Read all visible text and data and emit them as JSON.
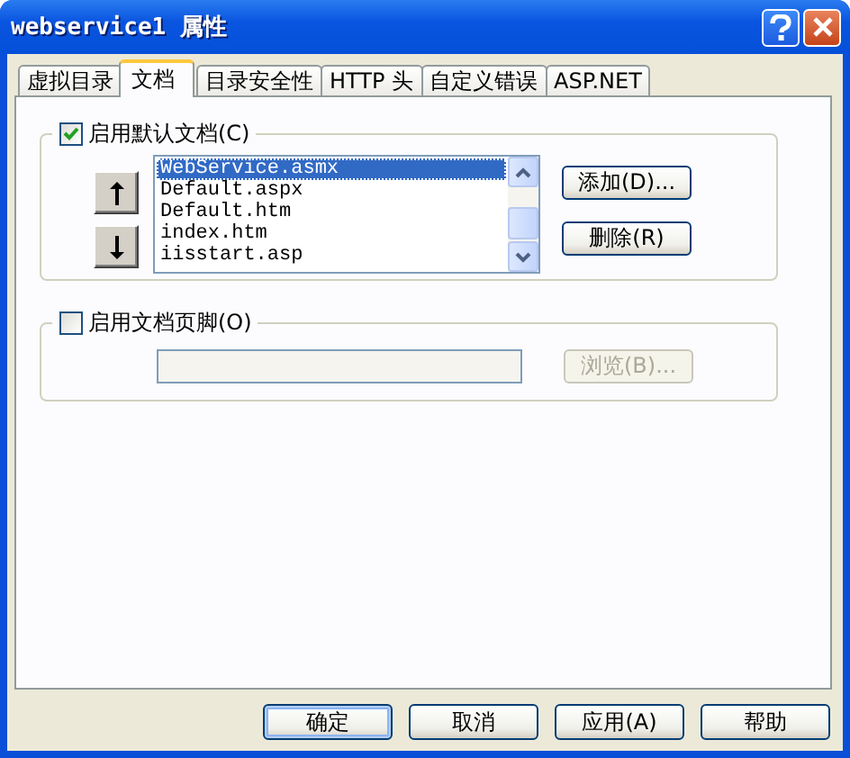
{
  "window": {
    "title": "webservice1 属性"
  },
  "tabs": [
    {
      "label": "虚拟目录",
      "selected": false
    },
    {
      "label": "文档",
      "selected": true
    },
    {
      "label": "目录安全性",
      "selected": false
    },
    {
      "label": "HTTP 头",
      "selected": false
    },
    {
      "label": "自定义错误",
      "selected": false
    },
    {
      "label": "ASP.NET",
      "selected": false
    }
  ],
  "default_document": {
    "label": "启用默认文档(C)",
    "checked": true,
    "documents": [
      {
        "name": "WebService.asmx",
        "selected": true
      },
      {
        "name": "Default.aspx",
        "selected": false
      },
      {
        "name": "Default.htm",
        "selected": false
      },
      {
        "name": "index.htm",
        "selected": false
      },
      {
        "name": "iisstart.asp",
        "selected": false
      }
    ],
    "buttons": [
      {
        "label": "添加(D)...",
        "disabled": false
      },
      {
        "label": "删除(R)",
        "disabled": false
      }
    ]
  },
  "document_footer": {
    "label": "启用文档页脚(O)",
    "checked": false,
    "path_field": {
      "disabled": true
    },
    "browse_button": {
      "label": "浏览(B)...",
      "disabled": true
    }
  },
  "dialog_buttons": [
    {
      "label": "确定",
      "default": true
    },
    {
      "label": "取消",
      "default": false
    },
    {
      "label": "应用(A)",
      "default": false
    },
    {
      "label": "帮助",
      "default": false
    }
  ]
}
